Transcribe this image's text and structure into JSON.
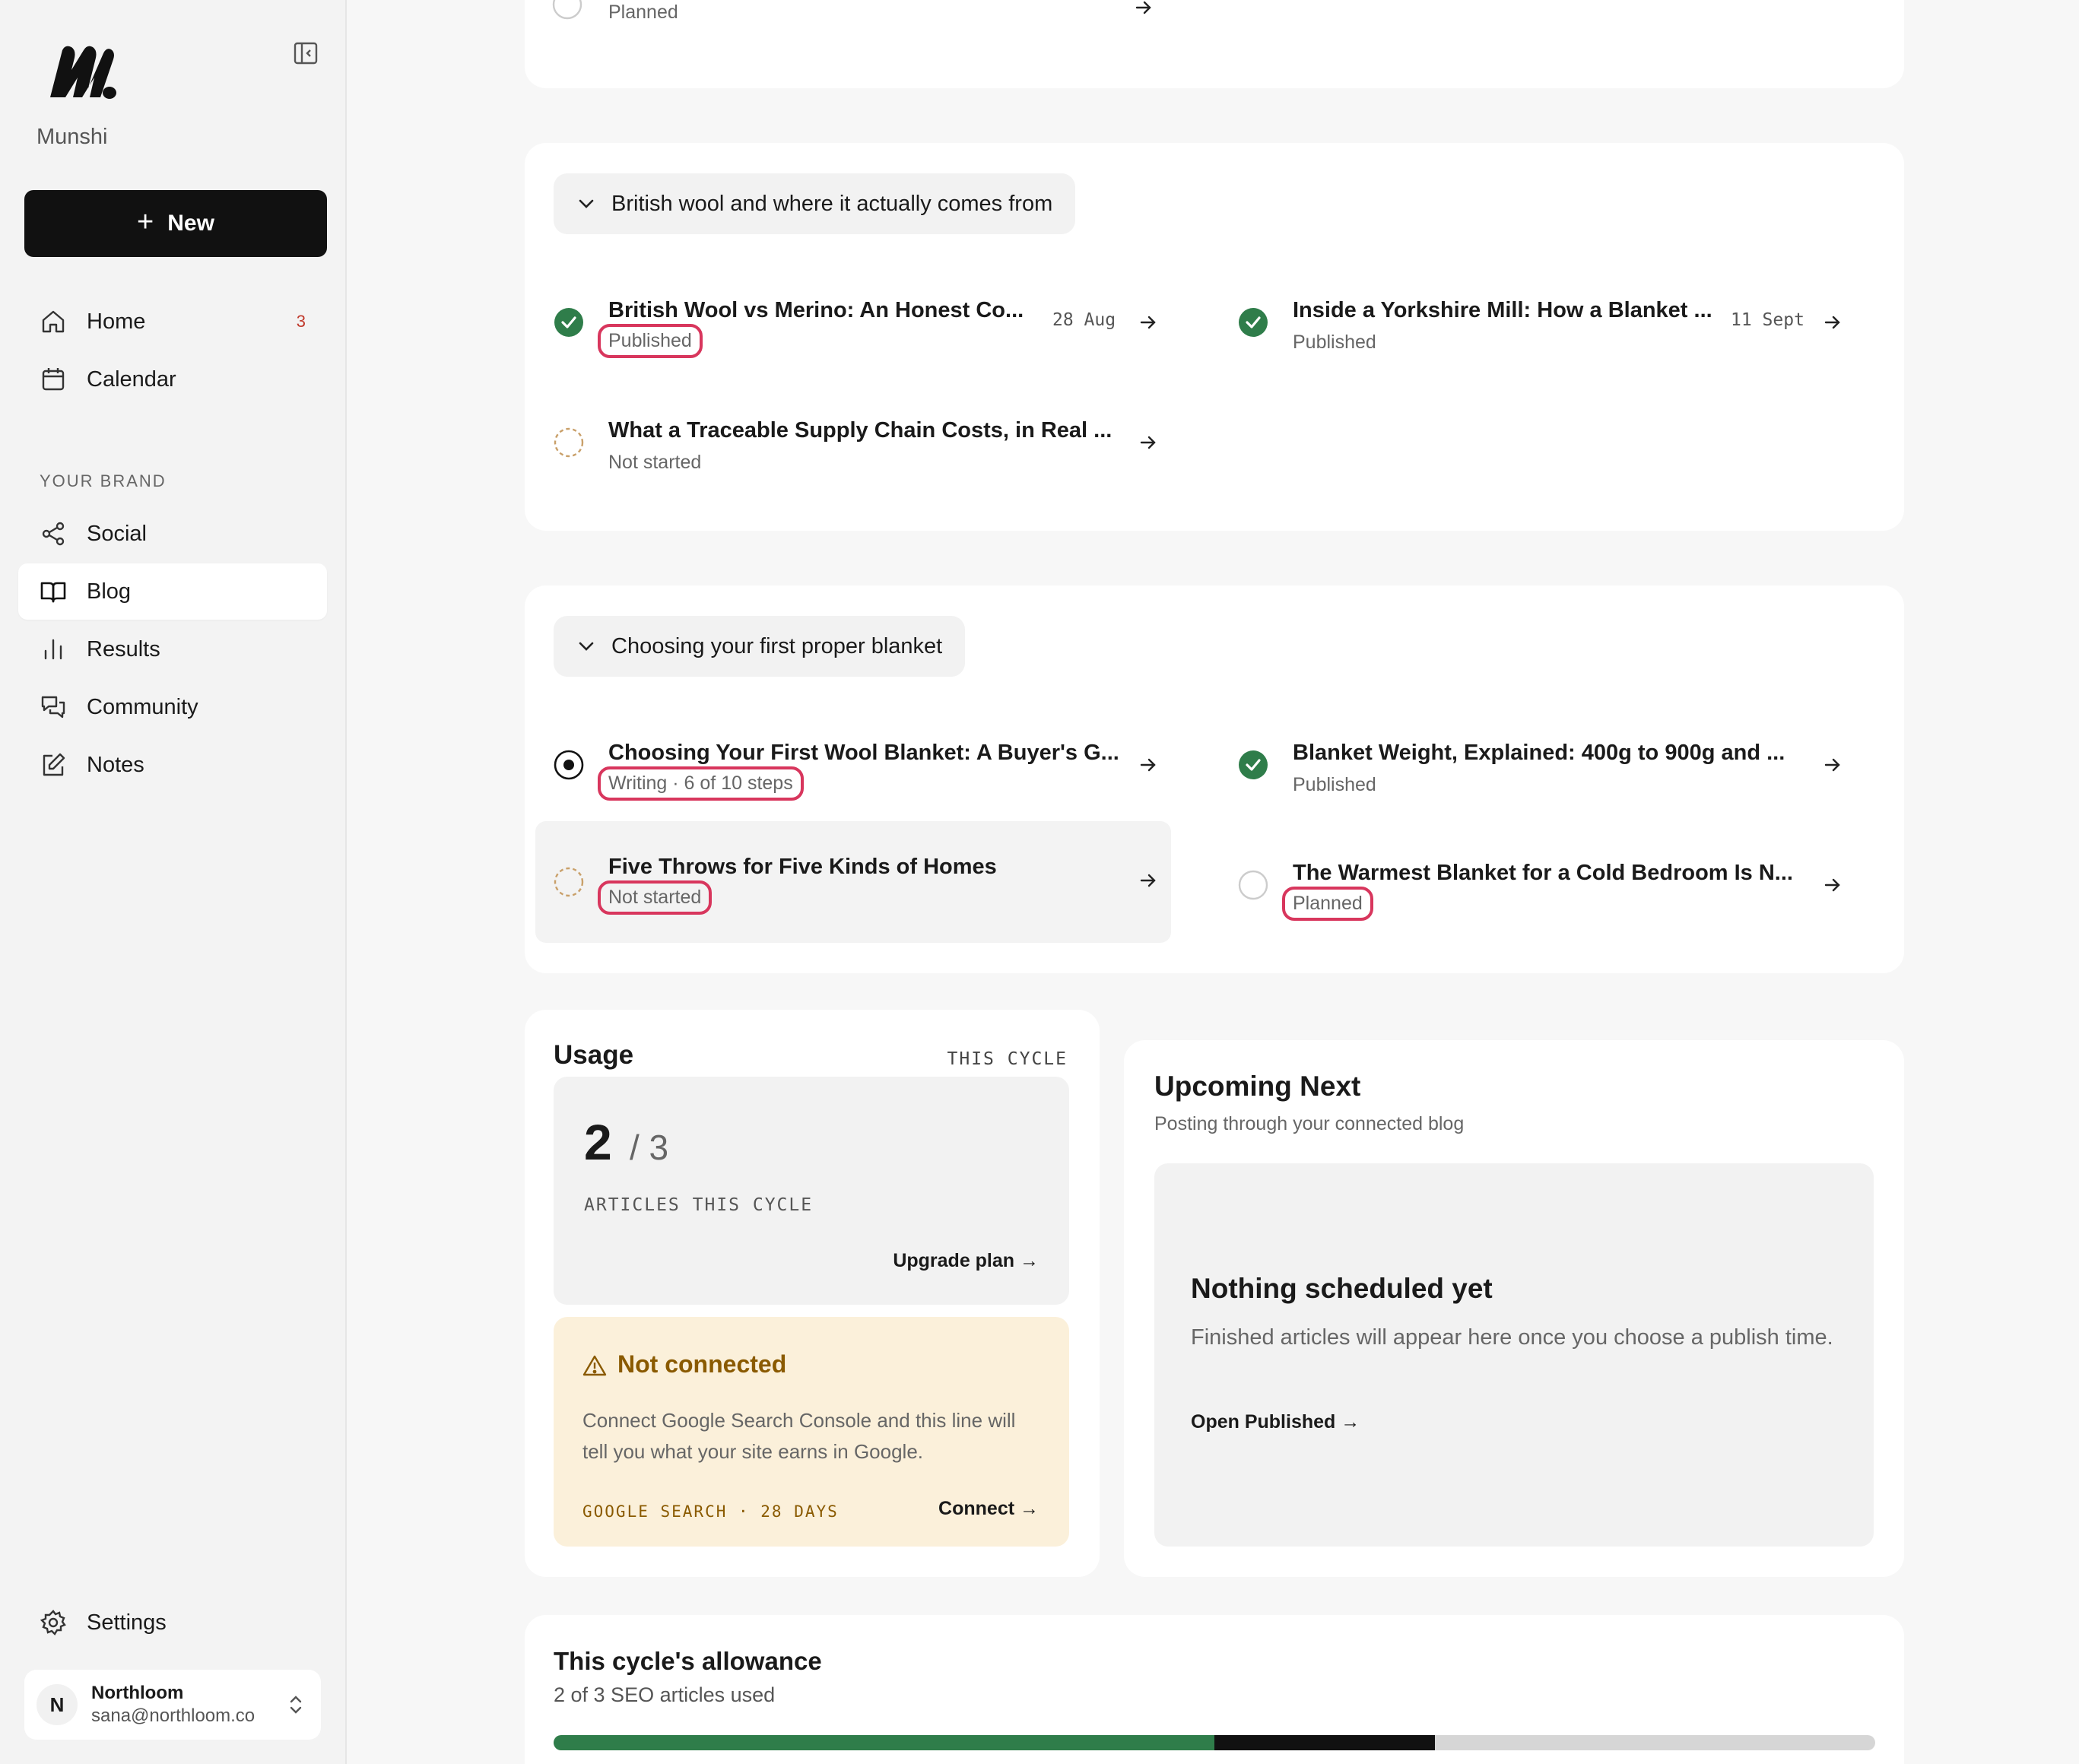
{
  "sidebar": {
    "brand": "Munshi",
    "new_label": "New",
    "nav": [
      {
        "label": "Home",
        "badge": "3"
      },
      {
        "label": "Calendar"
      }
    ],
    "section_label": "YOUR BRAND",
    "brand_nav": [
      {
        "label": "Social"
      },
      {
        "label": "Blog"
      },
      {
        "label": "Results"
      },
      {
        "label": "Community"
      },
      {
        "label": "Notes"
      }
    ],
    "settings_label": "Settings",
    "account": {
      "initial": "N",
      "name": "Northloom",
      "email": "sana@northloom.co"
    }
  },
  "top_partial": {
    "status": "Planned"
  },
  "group1": {
    "title": "British wool and where it actually comes from",
    "items": [
      {
        "title": "British Wool vs Merino: An Honest Co...",
        "status": "Published",
        "date": "28 Aug"
      },
      {
        "title": "Inside a Yorkshire Mill: How a Blanket ...",
        "status": "Published",
        "date": "11 Sept"
      },
      {
        "title": "What a Traceable Supply Chain Costs, in Real ...",
        "status": "Not started"
      }
    ]
  },
  "group2": {
    "title": "Choosing your first proper blanket",
    "items": [
      {
        "title": "Choosing Your First Wool Blanket: A Buyer's G...",
        "status": "Writing · 6 of 10 steps"
      },
      {
        "title": "Blanket Weight, Explained: 400g to 900g and ...",
        "status": "Published"
      },
      {
        "title": "Five Throws for Five Kinds of Homes",
        "status": "Not started"
      },
      {
        "title": "The Warmest Blanket for a Cold Bedroom Is N...",
        "status": "Planned"
      }
    ]
  },
  "usage": {
    "title": "Usage",
    "cycle_label": "THIS CYCLE",
    "used": "2",
    "total": "/ 3",
    "caption": "ARTICLES THIS CYCLE",
    "upgrade": "Upgrade plan →",
    "not_connected_title": "Not connected",
    "not_connected_body": "Connect Google Search Console and this line will tell you what your site earns in Google.",
    "source_label": "GOOGLE SEARCH · 28 DAYS",
    "connect": "Connect →"
  },
  "upcoming": {
    "title": "Upcoming Next",
    "subtitle": "Posting through your connected blog",
    "empty_title": "Nothing scheduled yet",
    "empty_body": "Finished articles will appear here once you choose a publish time.",
    "link": "Open Published →"
  },
  "allowance": {
    "title": "This cycle's allowance",
    "subtitle": "2 of 3 SEO articles used",
    "published_fraction": 0.5,
    "in_progress_fraction": 0.1667,
    "colors": {
      "published": "#2f7d4a",
      "in_progress": "#111111",
      "remaining": "#d6d6d6"
    }
  },
  "colors": {
    "accent": "#111111",
    "success": "#2f7d4a",
    "highlight": "#d8365d",
    "warning_bg": "#fbf0da",
    "warning_text": "#8a5a00"
  }
}
